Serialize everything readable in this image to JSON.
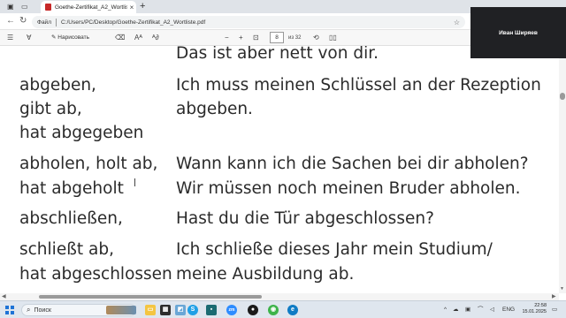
{
  "browser": {
    "tab_title": "Goethe-Zertifikat_A2_Wortliste.pdf",
    "tab_close": "×",
    "new_tab": "+",
    "url_prefix": "Файл",
    "url_path": "C:/Users/PC/Desktop/Goethe-Zertifikat_A2_Wortliste.pdf",
    "back": "←",
    "reload": "↻",
    "star": "☆"
  },
  "pdf_toolbar": {
    "draw_label": "Нарисовать",
    "zoom_out": "−",
    "zoom_in": "+",
    "page_current": "8",
    "page_total": "из 32"
  },
  "video_call": {
    "participant_name": "Иван Ширяев"
  },
  "document": {
    "lines": [
      {
        "col": "right",
        "text": "Das ist aber nett von dir."
      },
      {
        "col": "left",
        "text": "abgeben,"
      },
      {
        "col": "right",
        "text": "Ich muss meinen Schlüssel an der Rezeption"
      },
      {
        "col": "left",
        "text": "gibt ab,"
      },
      {
        "col": "right",
        "text": "abgeben."
      },
      {
        "col": "left",
        "text": "hat abgegeben"
      },
      {
        "col": "left",
        "text": "abholen, holt ab,"
      },
      {
        "col": "right",
        "text": "Wann kann ich die Sachen bei dir abholen?"
      },
      {
        "col": "left",
        "text": "hat abgeholt"
      },
      {
        "col": "right",
        "text": "Wir müssen noch meinen Bruder abholen."
      },
      {
        "col": "left",
        "text": "abschließen,"
      },
      {
        "col": "right",
        "text": "Hast du die Tür abgeschlossen?"
      },
      {
        "col": "left",
        "text": "schließt ab,"
      },
      {
        "col": "right",
        "text": "Ich schließe dieses Jahr mein Studium/"
      },
      {
        "col": "left",
        "text": "hat abgeschlossen"
      },
      {
        "col": "right",
        "text": "meine Ausbildung ab."
      }
    ]
  },
  "taskbar": {
    "search_placeholder": "Поиск",
    "language": "ENG",
    "time": "22:58",
    "date": "15.01.2025"
  }
}
